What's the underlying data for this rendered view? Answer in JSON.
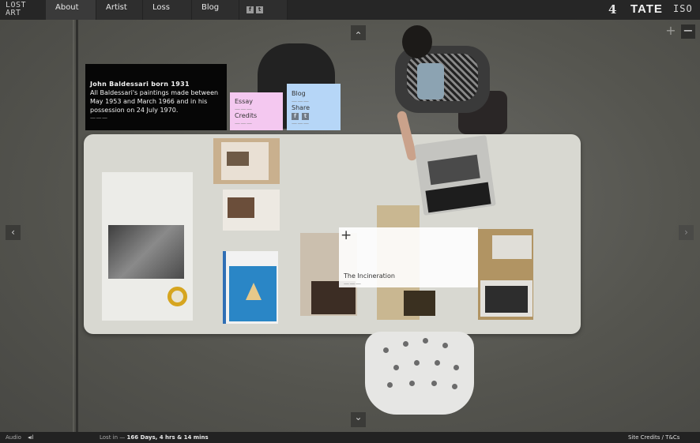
{
  "logo": {
    "line1": "LOST",
    "line2": "ART"
  },
  "nav": {
    "items": [
      "About",
      "Artist",
      "Loss",
      "Blog"
    ],
    "social": {
      "facebook": "f",
      "twitter": "t"
    }
  },
  "brands": {
    "channel4": "4",
    "tate": "TATE",
    "iso": "ISO"
  },
  "info_box": {
    "title": "John Baldessari born 1931",
    "body": "All Baldessari's paintings made between May 1953 and March 1966 and in his possession on 24 July 1970.",
    "more": "———"
  },
  "essay_box": {
    "essay": "Essay",
    "credits": "Credits",
    "more": "———"
  },
  "blog_box": {
    "blog": "Blog",
    "share": "Share",
    "facebook": "f",
    "twitter": "t",
    "more": "———"
  },
  "hotspot": {
    "plus": "+",
    "label": "The Incineration",
    "more": "———"
  },
  "controls": {
    "up": "⌃",
    "down": "⌄",
    "left": "‹",
    "right": "›",
    "zoom_in": "+",
    "zoom_out": "−"
  },
  "footer": {
    "audio_label": "Audio",
    "audio_icon": "speaker-icon",
    "lost_prefix": "Lost in —",
    "lost_value": "166 Days, 4 hrs & 14 mins",
    "credits": "Site Credits / T&Cs"
  },
  "colors": {
    "pink": "#f4c8f0",
    "blue": "#b6d6f7",
    "black_box": "#060606",
    "bar": "#262626"
  }
}
